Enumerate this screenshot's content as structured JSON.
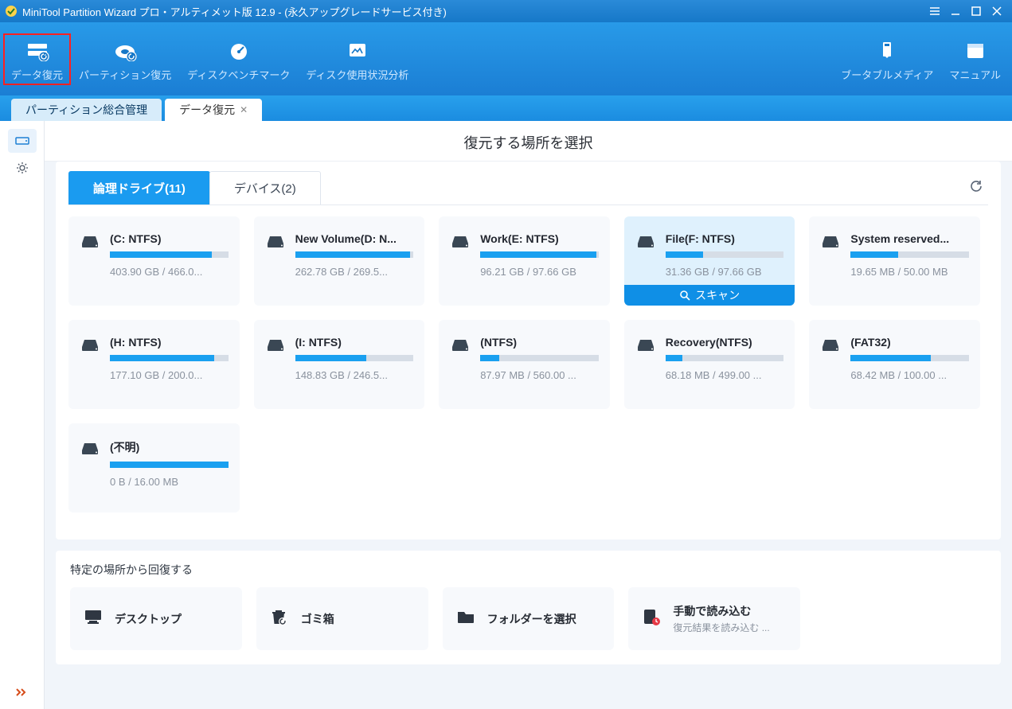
{
  "titlebar": {
    "text": "MiniTool Partition Wizard プロ・アルティメット版 12.9 - (永久アップグレードサービス付き)"
  },
  "toolbar": {
    "items": [
      {
        "label": "データ復元",
        "highlight": true
      },
      {
        "label": "パーティション復元"
      },
      {
        "label": "ディスクベンチマーク"
      },
      {
        "label": "ディスク使用状況分析"
      }
    ],
    "right": [
      {
        "label": "ブータブルメディア"
      },
      {
        "label": "マニュアル"
      }
    ]
  },
  "tabs": [
    {
      "label": "パーティション総合管理",
      "active": false,
      "closable": false
    },
    {
      "label": "データ復元",
      "active": true,
      "closable": true
    }
  ],
  "heading": "復元する場所を選択",
  "innerTabs": {
    "items": [
      {
        "label": "論理ドライブ(11)",
        "active": true
      },
      {
        "label": "デバイス(2)",
        "active": false
      }
    ]
  },
  "scan_label": "スキャン",
  "drives": [
    {
      "name": "(C: NTFS)",
      "usage": "403.90 GB / 466.0...",
      "fill": 86,
      "selected": false
    },
    {
      "name": "New Volume(D: N...",
      "usage": "262.78 GB / 269.5...",
      "fill": 97,
      "selected": false
    },
    {
      "name": "Work(E: NTFS)",
      "usage": "96.21 GB / 97.66 GB",
      "fill": 98,
      "selected": false
    },
    {
      "name": "File(F: NTFS)",
      "usage": "31.36 GB / 97.66 GB",
      "fill": 32,
      "selected": true
    },
    {
      "name": "System reserved...",
      "usage": "19.65 MB / 50.00 MB",
      "fill": 40,
      "selected": false
    },
    {
      "name": "(H: NTFS)",
      "usage": "177.10 GB / 200.0...",
      "fill": 88,
      "selected": false
    },
    {
      "name": "(I: NTFS)",
      "usage": "148.83 GB / 246.5...",
      "fill": 60,
      "selected": false
    },
    {
      "name": "(NTFS)",
      "usage": "87.97 MB / 560.00 ...",
      "fill": 16,
      "selected": false
    },
    {
      "name": "Recovery(NTFS)",
      "usage": "68.18 MB / 499.00 ...",
      "fill": 14,
      "selected": false
    },
    {
      "name": "(FAT32)",
      "usage": "68.42 MB / 100.00 ...",
      "fill": 68,
      "selected": false
    },
    {
      "name": "(不明)",
      "usage": "0 B / 16.00 MB",
      "fill": 100,
      "selected": false
    }
  ],
  "lower": {
    "title": "特定の場所から回復する",
    "items": [
      {
        "title": "デスクトップ",
        "sub": ""
      },
      {
        "title": "ゴミ箱",
        "sub": ""
      },
      {
        "title": "フォルダーを選択",
        "sub": ""
      },
      {
        "title": "手動で読み込む",
        "sub": "復元結果を読み込む ..."
      }
    ]
  }
}
